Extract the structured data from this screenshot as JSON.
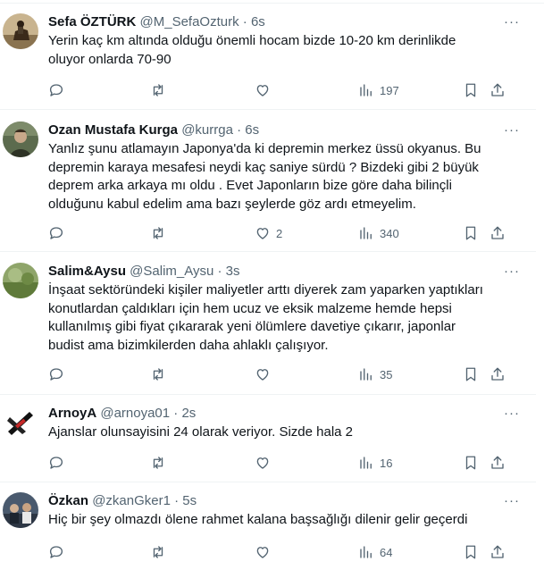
{
  "tweets": [
    {
      "name": "Sefa ÖZTÜRK",
      "handle": "@M_SefaOzturk",
      "dot": "·",
      "time": "6s",
      "text": "Yerin kaç km altında olduğu önemli hocam bizde 10-20 km derinlikde\noluyor onlarda 70-90",
      "likes": "",
      "views": "197",
      "avatar": "avatar-horse-rider"
    },
    {
      "name": "Ozan Mustafa Kurga",
      "handle": "@kurrga",
      "dot": "·",
      "time": "6s",
      "text": "Yanlız şunu atlamayın Japonya'da ki depremin merkez üssü okyanus. Bu\ndepremin karaya mesafesi neydi kaç saniye sürdü ? Bizdeki gibi 2 büyük\ndeprem arka arkaya mı oldu . Evet Japonların bize göre daha bilinçli\nolduğunu kabul edelim ama bazı şeylerde göz ardı etmeyelim.",
      "likes": "2",
      "views": "340",
      "avatar": "avatar-profile-photo"
    },
    {
      "name": "Salim&Aysu",
      "handle": "@Salim_Aysu",
      "dot": "·",
      "time": "3s",
      "text": "İnşaat sektöründeki kişiler maliyetler arttı diyerek zam yaparken yaptıkları\nkonutlardan çaldıkları için hem ucuz ve eksik malzeme hemde hepsi\nkullanılmış gibi fiyat çıkararak yeni ölümlere davetiye çıkarır, japonlar\nbudist ama bizimkilerden daha ahlaklı çalışıyor.",
      "likes": "",
      "views": "35",
      "avatar": "avatar-nature-photo"
    },
    {
      "name": "ArnoyA",
      "handle": "@arnoya01",
      "dot": "·",
      "time": "2s",
      "text": "Ajanslar olunsayisini 24 olarak veriyor. Sizde hala 2",
      "likes": "",
      "views": "16",
      "avatar": "avatar-logo"
    },
    {
      "name": "Özkan",
      "handle": "@zkanGker1",
      "dot": "·",
      "time": "5s",
      "text": "Hiç bir şey olmazdı ölene rahmet kalana başsağlığı dilenir gelir geçerdi",
      "likes": "",
      "views": "64",
      "avatar": "avatar-group-photo"
    }
  ],
  "more_glyph": "···",
  "colors": {
    "text": "#0f1419",
    "secondary": "#536471",
    "border": "#eff3f4"
  }
}
